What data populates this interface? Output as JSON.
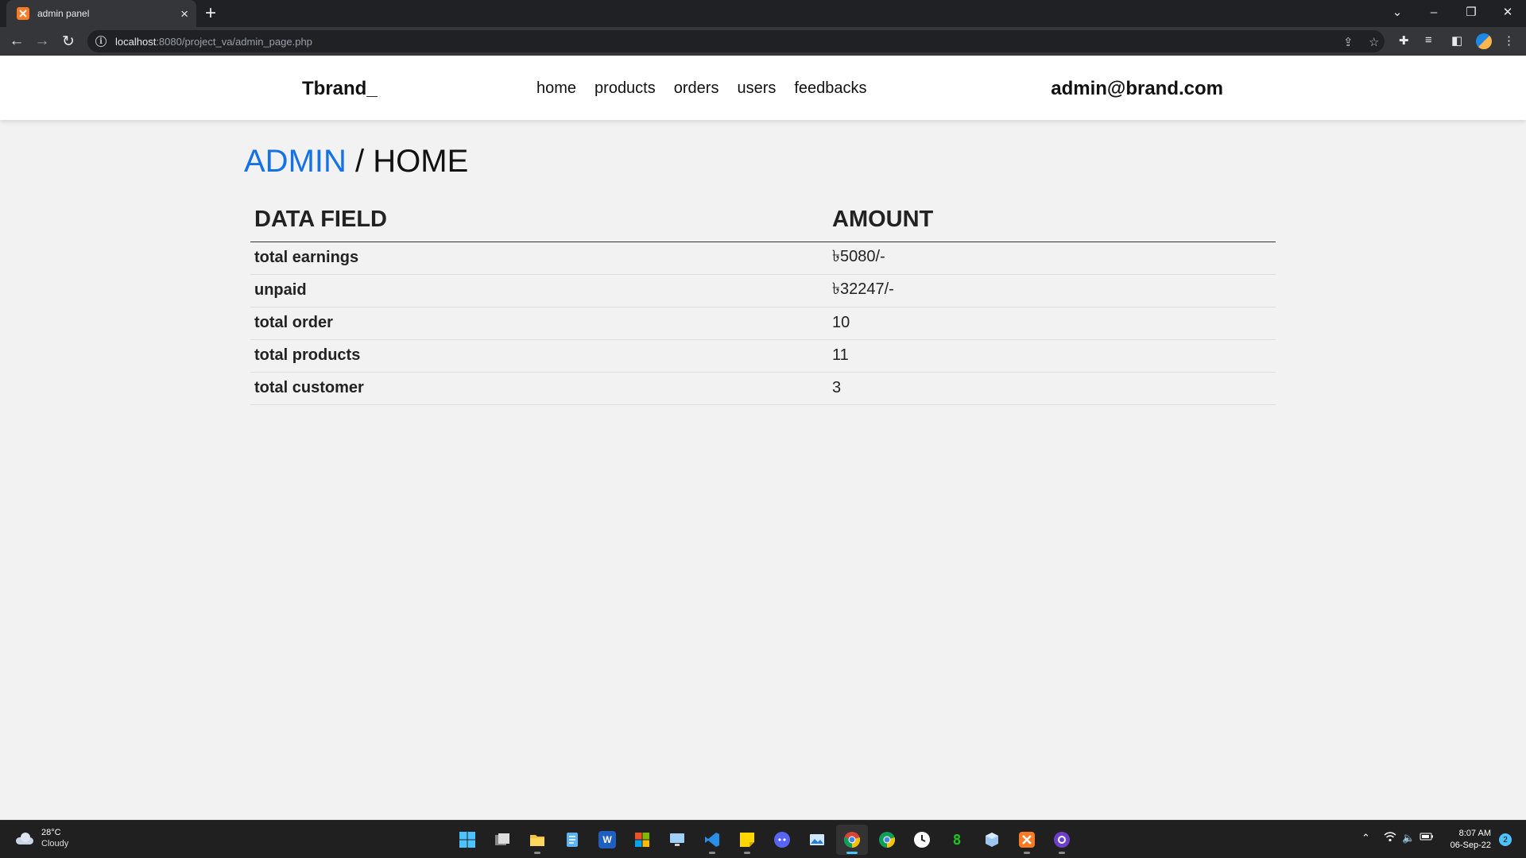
{
  "browser": {
    "tab_title": "admin panel",
    "tab_favicon": "xampp-favicon-icon",
    "url_host": "localhost",
    "url_rest": ":8080/project_va/admin_page.php"
  },
  "header": {
    "logo": "Tbrand_",
    "nav": [
      "home",
      "products",
      "orders",
      "users",
      "feedbacks"
    ],
    "admin_email": "admin@brand.com"
  },
  "page": {
    "breadcrumb_admin": "ADMIN",
    "breadcrumb_sep": "/",
    "breadcrumb_home": "HOME",
    "accent_color": "#1471e6"
  },
  "table": {
    "headers": [
      "DATA FIELD",
      "AMOUNT"
    ],
    "rows": [
      {
        "field": "total earnings",
        "amount": "৳5080/-"
      },
      {
        "field": "unpaid",
        "amount": "৳32247/-"
      },
      {
        "field": "total order",
        "amount": "10"
      },
      {
        "field": "total products",
        "amount": "11"
      },
      {
        "field": "total customer",
        "amount": "3"
      }
    ]
  },
  "taskbar": {
    "weather_temp": "28°C",
    "weather_desc": "Cloudy",
    "time": "8:07 AM",
    "date": "06-Sep-22",
    "notification_count": "2",
    "apps": [
      "windows-start-icon",
      "task-view-icon",
      "file-explorer-icon",
      "notepad-icon",
      "word-icon",
      "microsoft-store-icon",
      "remote-desktop-icon",
      "vscode-icon",
      "sticky-notes-icon",
      "discord-icon",
      "photos-icon",
      "chrome-icon",
      "chrome-alt-icon",
      "clock-icon",
      "terminal-icon",
      "virtualbox-icon",
      "xampp-icon",
      "github-desktop-icon"
    ],
    "active_app": "chrome-icon"
  }
}
